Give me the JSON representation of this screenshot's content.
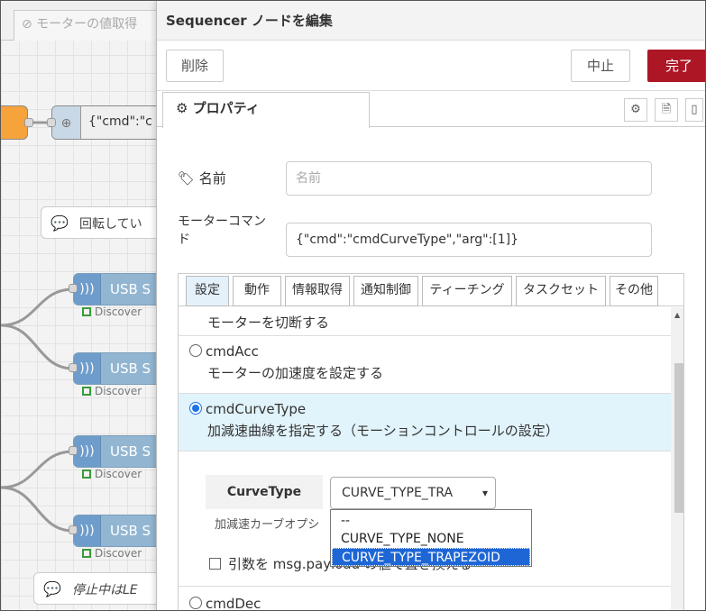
{
  "canvas": {
    "tab_label": "⊘ モーターの値取得",
    "inject_label": "{\"cmd\":\"c",
    "comment1_label": "回転してい",
    "comment2_label": "停止中はLE",
    "usb_nodes": [
      {
        "label": "USB S",
        "status": "Discover"
      },
      {
        "label": "USB S",
        "status": "Discover"
      },
      {
        "label": "USB S",
        "status": "Discover"
      },
      {
        "label": "USB S",
        "status": "Discover"
      }
    ]
  },
  "tray": {
    "title": "Sequencer ノードを編集",
    "delete_label": "削除",
    "cancel_label": "中止",
    "done_label": "完了",
    "properties_tab": "⚙ プロパティ",
    "name_label": "🏷 名前",
    "name_placeholder": "名前",
    "motor_cmd_label_1": "モーターコマン",
    "motor_cmd_label_2": "ド",
    "motor_cmd_value": "{\"cmd\":\"cmdCurveType\",\"arg\":[1]}"
  },
  "cmd_tabs": [
    "設定",
    "動作",
    "情報取得",
    "通知制御",
    "ティーチング",
    "タスクセット",
    "その他"
  ],
  "cmd_list": {
    "partial_top_desc": "モーターを切断する",
    "items": [
      {
        "name": "cmdAcc",
        "desc": "モーターの加速度を設定する",
        "selected": false
      },
      {
        "name": "cmdCurveType",
        "desc": "加減速曲線を指定する（モーションコントロールの設定）",
        "selected": true
      }
    ],
    "curve_type_label": "CurveType",
    "curve_type_value": "CURVE_TYPE_TRA",
    "curve_hint": "加減速カーブオプシ",
    "checkbox_label": "引数を msg.payload の値で置き換える",
    "next_item_partial": "cmdDec"
  },
  "dropdown_options": [
    "--",
    "CURVE_TYPE_NONE",
    "CURVE_TYPE_TRAPEZOID"
  ],
  "colors": {
    "done": "#ad1625",
    "selected_row": "#e1f3fb",
    "usb_node": "#92b6d2",
    "accent": "#1e66d6"
  }
}
